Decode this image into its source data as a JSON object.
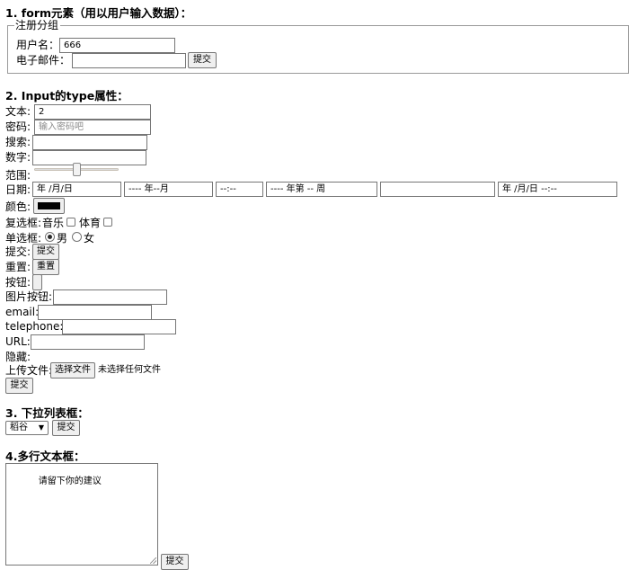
{
  "sections": {
    "s1": "1. form元素（用以用户输入数据）：",
    "s2": "2. Input的type属性：",
    "s3": "3. 下拉列表框：",
    "s4": "4.多行文本框："
  },
  "register": {
    "legend": "注册分组",
    "username_label": "用户名：",
    "username_value": "666",
    "email_label": "电子邮件：",
    "email_value": "",
    "submit": "提交"
  },
  "input_types": {
    "text_label": "文本:",
    "text_value": "2",
    "password_label": "密码:",
    "password_placeholder": "输入密码吧",
    "search_label": "搜索:",
    "number_label": "数字:",
    "range_label": "范围:",
    "range_value": 0.5,
    "date_label": "日期:",
    "date_value": "年 /月/日",
    "month_value": "---- 年--月",
    "time_value": "--:--",
    "week_value": "---- 年第 -- 周",
    "empty_field": "",
    "datetime_value": "年 /月/日 --:--",
    "color_label": "颜色:",
    "color_value": "#000000",
    "checkbox_label": "复选框:",
    "checkbox_music": "音乐",
    "checkbox_sports": "体育",
    "radio_label": "单选框:",
    "radio_male": "男",
    "radio_female": "女",
    "submit_label": "提交:",
    "submit_btn": "提交",
    "reset_label": "重置:",
    "reset_btn": "重置",
    "button_label": "按钮:",
    "image_button_label": "图片按钮:",
    "email_label": "email:",
    "telephone_label": "telephone:",
    "url_label": "URL:",
    "hidden_label": "隐藏:",
    "file_label": "上传文件:",
    "file_button": "选择文件",
    "file_status": "未选择任何文件",
    "final_submit": "提交"
  },
  "dropdown": {
    "selected": "稻谷",
    "submit": "提交"
  },
  "textarea": {
    "content": "        请留下你的建议",
    "submit": "提交"
  }
}
